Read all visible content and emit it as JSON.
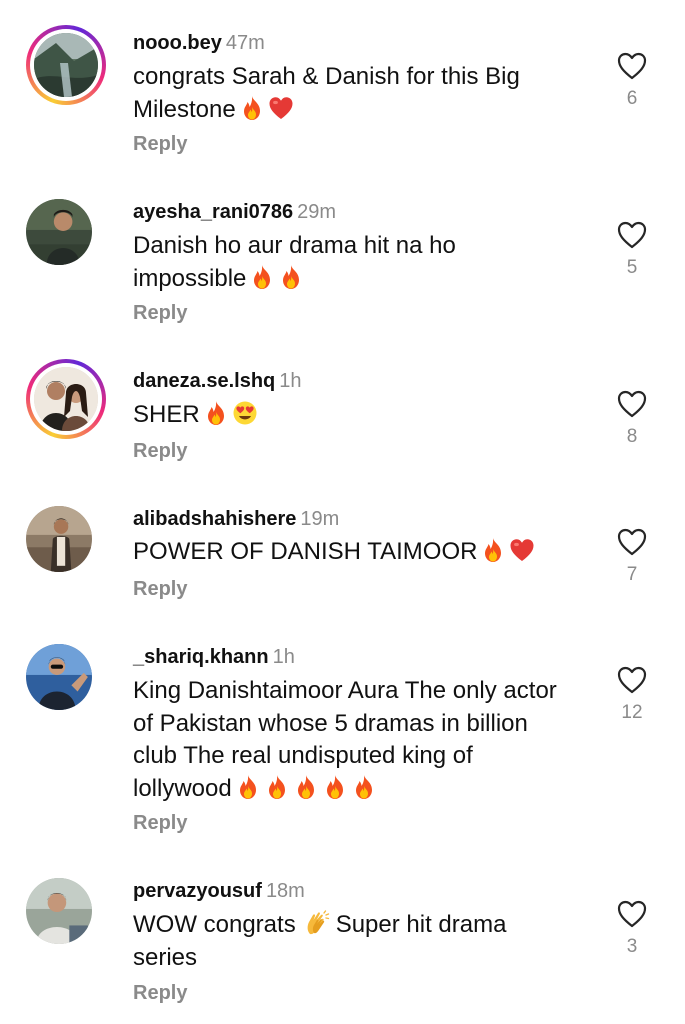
{
  "comments": [
    {
      "username": "nooo.bey",
      "time": "47m",
      "text": "congrats Sarah & Danish for this Big Milestone",
      "emojis": [
        "fire",
        "red-heart"
      ],
      "reply": "Reply",
      "likes": "6",
      "story_ring": true
    },
    {
      "username": "ayesha_rani0786",
      "time": "29m",
      "text": "Danish ho aur drama hit na ho impossible",
      "emojis": [
        "fire",
        "fire"
      ],
      "reply": "Reply",
      "likes": "5",
      "story_ring": false
    },
    {
      "username": "daneza.se.lshq",
      "time": "1h",
      "text": "SHER",
      "emojis": [
        "fire",
        "heart-eyes"
      ],
      "reply": "Reply",
      "likes": "8",
      "story_ring": true
    },
    {
      "username": "alibadshahishere",
      "time": "19m",
      "text": "POWER OF DANISH TAIMOOR",
      "emojis": [
        "fire",
        "red-heart"
      ],
      "reply": "Reply",
      "likes": "7",
      "story_ring": false
    },
    {
      "username": "_shariq.khann",
      "time": "1h",
      "text": "King Danishtaimoor Aura The only actor of Pakistan whose 5 dramas in billion club The real undisputed king of lollywood",
      "emojis": [
        "fire",
        "fire",
        "fire",
        "fire",
        "fire"
      ],
      "reply": "Reply",
      "likes": "12",
      "story_ring": false
    },
    {
      "username": "pervazyousuf",
      "time": "18m",
      "text_before": "WOW congrats",
      "text_after": "Super hit drama series",
      "emojis": [
        "clapping-hands"
      ],
      "reply": "Reply",
      "likes": "3",
      "story_ring": false
    }
  ],
  "icons": {
    "like": "heart-outline-icon"
  },
  "colors": {
    "muted": "#8a8a8a",
    "ring_start": "#f9ce34",
    "ring_mid": "#ee2a7b",
    "ring_end": "#6228d7"
  }
}
